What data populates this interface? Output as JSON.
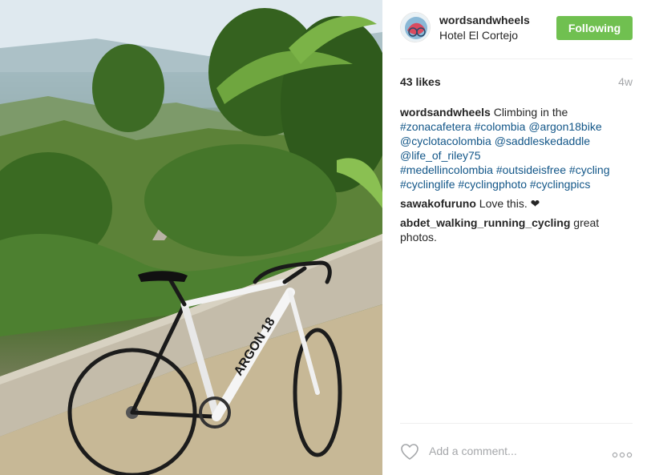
{
  "post": {
    "image_alt": "Road bike leaning against a wall overlooking green hills",
    "bike_brand": "ARGON 18"
  },
  "header": {
    "username": "wordsandwheels",
    "location": "Hotel El Cortejo",
    "follow_label": "Following",
    "follow_color": "#70c050"
  },
  "stats": {
    "likes": "43 likes",
    "time": "4w"
  },
  "caption": {
    "user": "wordsandwheels",
    "text": "Climbing in the",
    "tags": [
      "#zonacafetera",
      "#colombia",
      "@argon18bike",
      "@cyclotacolombia",
      "@saddleskedaddle",
      "@life_of_riley75",
      "#medellincolombia",
      "#outsideisfree",
      "#cycling",
      "#cyclinglife",
      "#cyclingphoto",
      "#cyclingpics"
    ]
  },
  "comments": [
    {
      "user": "sawakofuruno",
      "text": "Love this. ❤"
    },
    {
      "user": "abdet_walking_running_cycling",
      "text": "great photos."
    }
  ],
  "footer": {
    "comment_placeholder": "Add a comment...",
    "like_icon": "heart-icon",
    "more_icon": "more-options-icon"
  },
  "colors": {
    "link": "#125688",
    "muted": "#a5a7aa",
    "text": "#262626"
  }
}
